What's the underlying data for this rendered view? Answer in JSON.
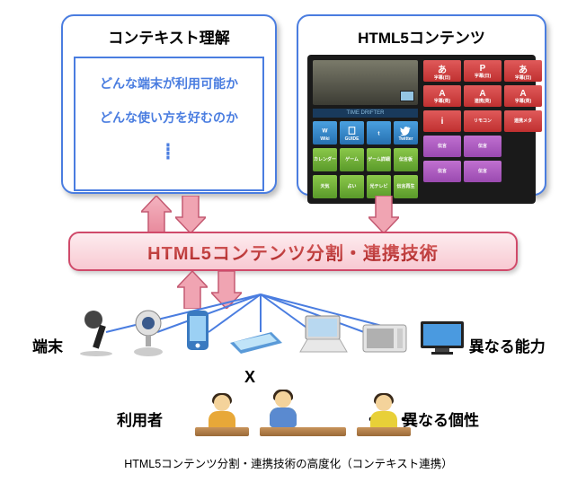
{
  "box_left": {
    "title": "コンテキスト理解",
    "line1": "どんな端末が利用可能か",
    "line2": "どんな使い方を好むのか",
    "dots": "┋"
  },
  "box_right": {
    "title": "HTML5コンテンツ",
    "video_label": "TIME DRIFTER",
    "blue_tiles": [
      "Wiki",
      "GUIDE",
      "t",
      "Twitter"
    ],
    "green_tiles": [
      "カレンダー",
      "ゲーム",
      "ゲーム詳細",
      "伝言板",
      "天気",
      "占い",
      "光テレビ",
      "伝言再生"
    ],
    "red_tiles": [
      "あ",
      "P",
      "あ",
      "字幕(日)",
      "字幕(日)",
      "字幕(日)",
      "A",
      "A",
      "A",
      "字幕(英)",
      "連携(英)",
      "字幕(英)",
      "i",
      "リモコン",
      "連携メタ"
    ],
    "purple_tiles": [
      "伝言",
      "伝言",
      "伝言",
      "伝言"
    ]
  },
  "pink_bar": "HTML5コンテンツ分割・連携技術",
  "device": {
    "left_label": "端末",
    "right_label": "・・・ 異なる能力",
    "x": "X"
  },
  "user": {
    "left_label": "利用者",
    "right_label": "異なる個性",
    "dots": "・・・"
  },
  "caption": "HTML5コンテンツ分割・連携技術の高度化（コンテキスト連携）"
}
